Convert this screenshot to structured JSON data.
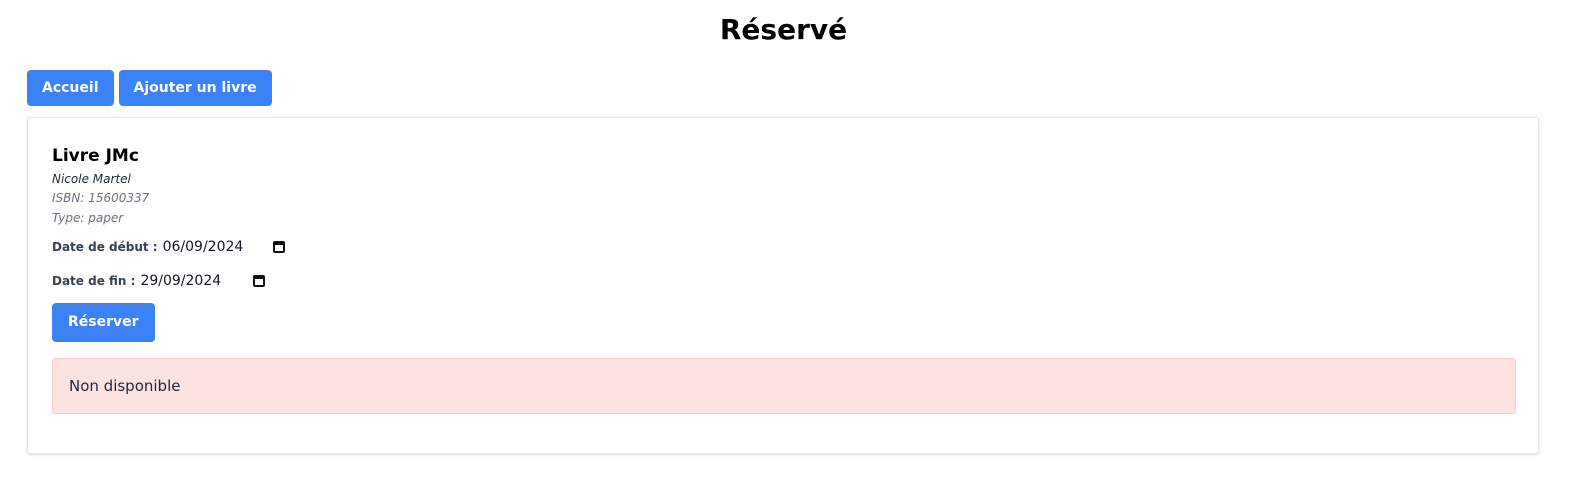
{
  "page": {
    "title": "Réservé"
  },
  "nav": {
    "home_label": "Accueil",
    "add_book_label": "Ajouter un livre"
  },
  "book": {
    "title": "Livre JMc",
    "author": "Nicole Martel",
    "isbn": "ISBN: 15600337",
    "type": "Type: paper"
  },
  "reservation": {
    "start_label": "Date de début :",
    "start_value": "06/09/2024",
    "end_label": "Date de fin :",
    "end_value": "29/09/2024",
    "submit_label": "Réserver"
  },
  "alert": {
    "message": "Non disponible"
  },
  "colors": {
    "primary": "#3b82f6",
    "alert_bg": "#fde2e2"
  },
  "icons": {
    "calendar": "calendar-icon"
  }
}
